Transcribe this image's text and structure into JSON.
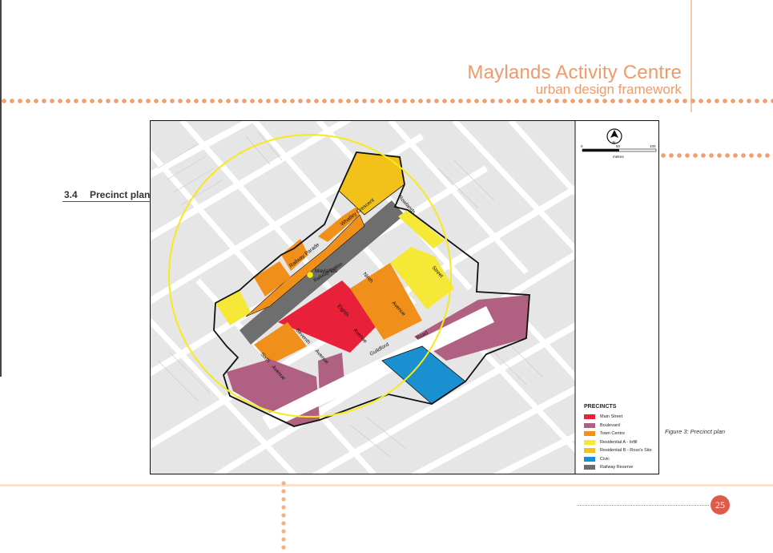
{
  "header": {
    "title": "Maylands Activity Centre",
    "subtitle": "urban design framework"
  },
  "section": {
    "number": "3.4",
    "title": "Precinct plan"
  },
  "map": {
    "station_name": "Maylands",
    "station_sublabel": "Railway Station",
    "scale_units": "metres",
    "scale_ticks": [
      "0",
      "50",
      "100"
    ],
    "north_symbol": "N",
    "street_labels": [
      "Railway Parade",
      "Whatley Crescent",
      "Rowlands",
      "Street",
      "Ninth",
      "Avenue",
      "Eighth",
      "Avenue",
      "Seventh",
      "Avenue",
      "Sixth",
      "Avenue",
      "Guildford",
      "Road"
    ]
  },
  "legend": {
    "title": "PRECINCTS",
    "items": [
      {
        "label": "Main Street",
        "color": "#e8203a"
      },
      {
        "label": "Boulevard",
        "color": "#b06080"
      },
      {
        "label": "Town Centre",
        "color": "#f0901a"
      },
      {
        "label": "Residential A - Infill",
        "color": "#f5e836"
      },
      {
        "label": "Residential B - Ross's Site",
        "color": "#f2c21a"
      },
      {
        "label": "Civic",
        "color": "#1a90d0"
      },
      {
        "label": "Railway Reserve",
        "color": "#6e6e6e"
      }
    ]
  },
  "caption": "Figure 3: Precinct plan",
  "page_number": "25"
}
